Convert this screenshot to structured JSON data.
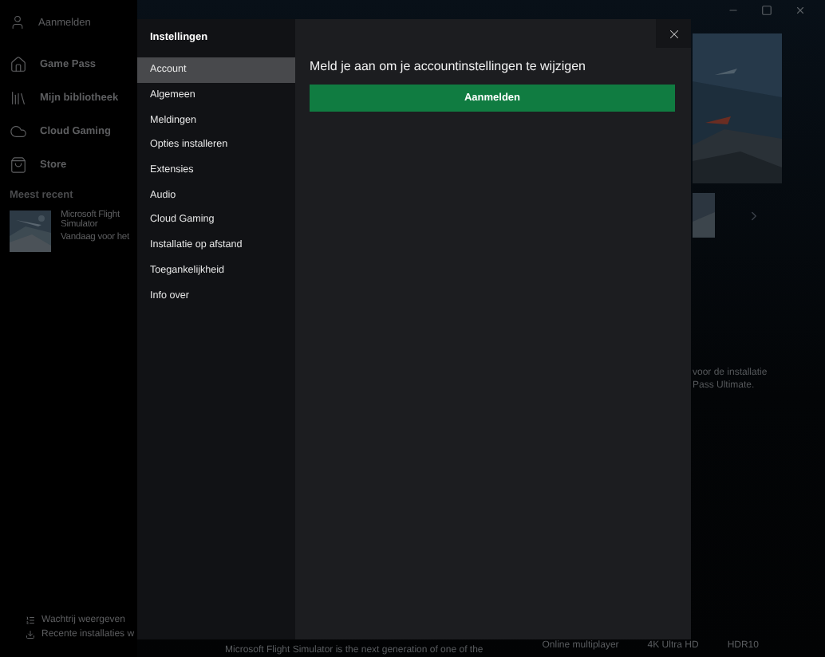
{
  "background": {
    "account": "Aanmelden",
    "nav": [
      {
        "kind": "home",
        "label": "Game Pass"
      },
      {
        "kind": "library",
        "label": "Mijn bibliotheek"
      },
      {
        "kind": "cloud",
        "label": "Cloud Gaming"
      },
      {
        "kind": "store",
        "label": "Store"
      }
    ],
    "recent_heading": "Meest recent",
    "recent": [
      {
        "kind": "picture",
        "title": "Microsoft Flight Simulator",
        "subtitle": "Vandaag voor het"
      }
    ],
    "queue": [
      {
        "kind": "queue",
        "label": "Wachtrij weergeven"
      },
      {
        "kind": "installs",
        "label": "Recente installaties w"
      }
    ],
    "promo_lines": [
      "voor de installatie",
      "Pass Ultimate."
    ],
    "features": [
      "Online multiplayer",
      "4K Ultra HD",
      "HDR10"
    ],
    "description": "Microsoft Flight Simulator is the next generation of one of the"
  },
  "settings": {
    "title": "Instellingen",
    "tabs": [
      {
        "label": "Account",
        "selected": true
      },
      {
        "label": "Algemeen",
        "selected": false
      },
      {
        "label": "Meldingen",
        "selected": false
      },
      {
        "label": "Opties installeren",
        "selected": false
      },
      {
        "label": "Extensies",
        "selected": false
      },
      {
        "label": "Audio",
        "selected": false
      },
      {
        "label": "Cloud Gaming",
        "selected": false
      },
      {
        "label": "Installatie op afstand",
        "selected": false
      },
      {
        "label": "Toegankelijkheid",
        "selected": false
      },
      {
        "label": "Info over",
        "selected": false
      }
    ],
    "heading": "Meld je aan om je accountinstellingen te wijzigen",
    "button": "Aanmelden"
  }
}
